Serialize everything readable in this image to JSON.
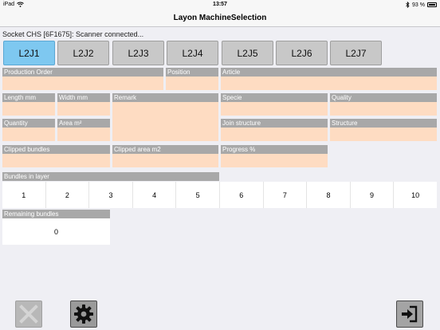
{
  "status_bar": {
    "device": "iPad",
    "time": "13:57",
    "battery": "93 %"
  },
  "nav": {
    "title": "Layon MachineSelection"
  },
  "status_message": "Socket CHS [6F1675]: Scanner connected...",
  "machines": [
    "L2J1",
    "L2J2",
    "L2J3",
    "L2J4",
    "L2J5",
    "L2J6",
    "L2J7"
  ],
  "active_machine": "L2J1",
  "fields": {
    "production_order": {
      "label": "Production Order",
      "value": ""
    },
    "position": {
      "label": "Position",
      "value": ""
    },
    "article": {
      "label": "Article",
      "value": ""
    },
    "length": {
      "label": "Length mm",
      "value": ""
    },
    "width": {
      "label": "Width mm",
      "value": ""
    },
    "remark": {
      "label": "Remark",
      "value": ""
    },
    "specie": {
      "label": "Specie",
      "value": ""
    },
    "quality": {
      "label": "Quality",
      "value": ""
    },
    "quantity": {
      "label": "Quantity",
      "value": ""
    },
    "area": {
      "label": "Area m²",
      "value": ""
    },
    "join_structure": {
      "label": "Join structure",
      "value": ""
    },
    "structure": {
      "label": "Structure",
      "value": ""
    },
    "clipped_bundles": {
      "label": "Clipped bundles",
      "value": ""
    },
    "clipped_area": {
      "label": "Clipped area m2",
      "value": ""
    },
    "progress": {
      "label": "Progress %",
      "value": ""
    }
  },
  "bundles_in_layer": {
    "label": "Bundles in layer",
    "cells": [
      "1",
      "2",
      "3",
      "4",
      "5",
      "6",
      "7",
      "8",
      "9",
      "10"
    ]
  },
  "remaining_bundles": {
    "label": "Remaining bundles",
    "value": "0"
  },
  "toolbar": {
    "cancel_icon": "close-icon",
    "settings_icon": "gear-icon",
    "exit_icon": "sign-in-icon"
  }
}
